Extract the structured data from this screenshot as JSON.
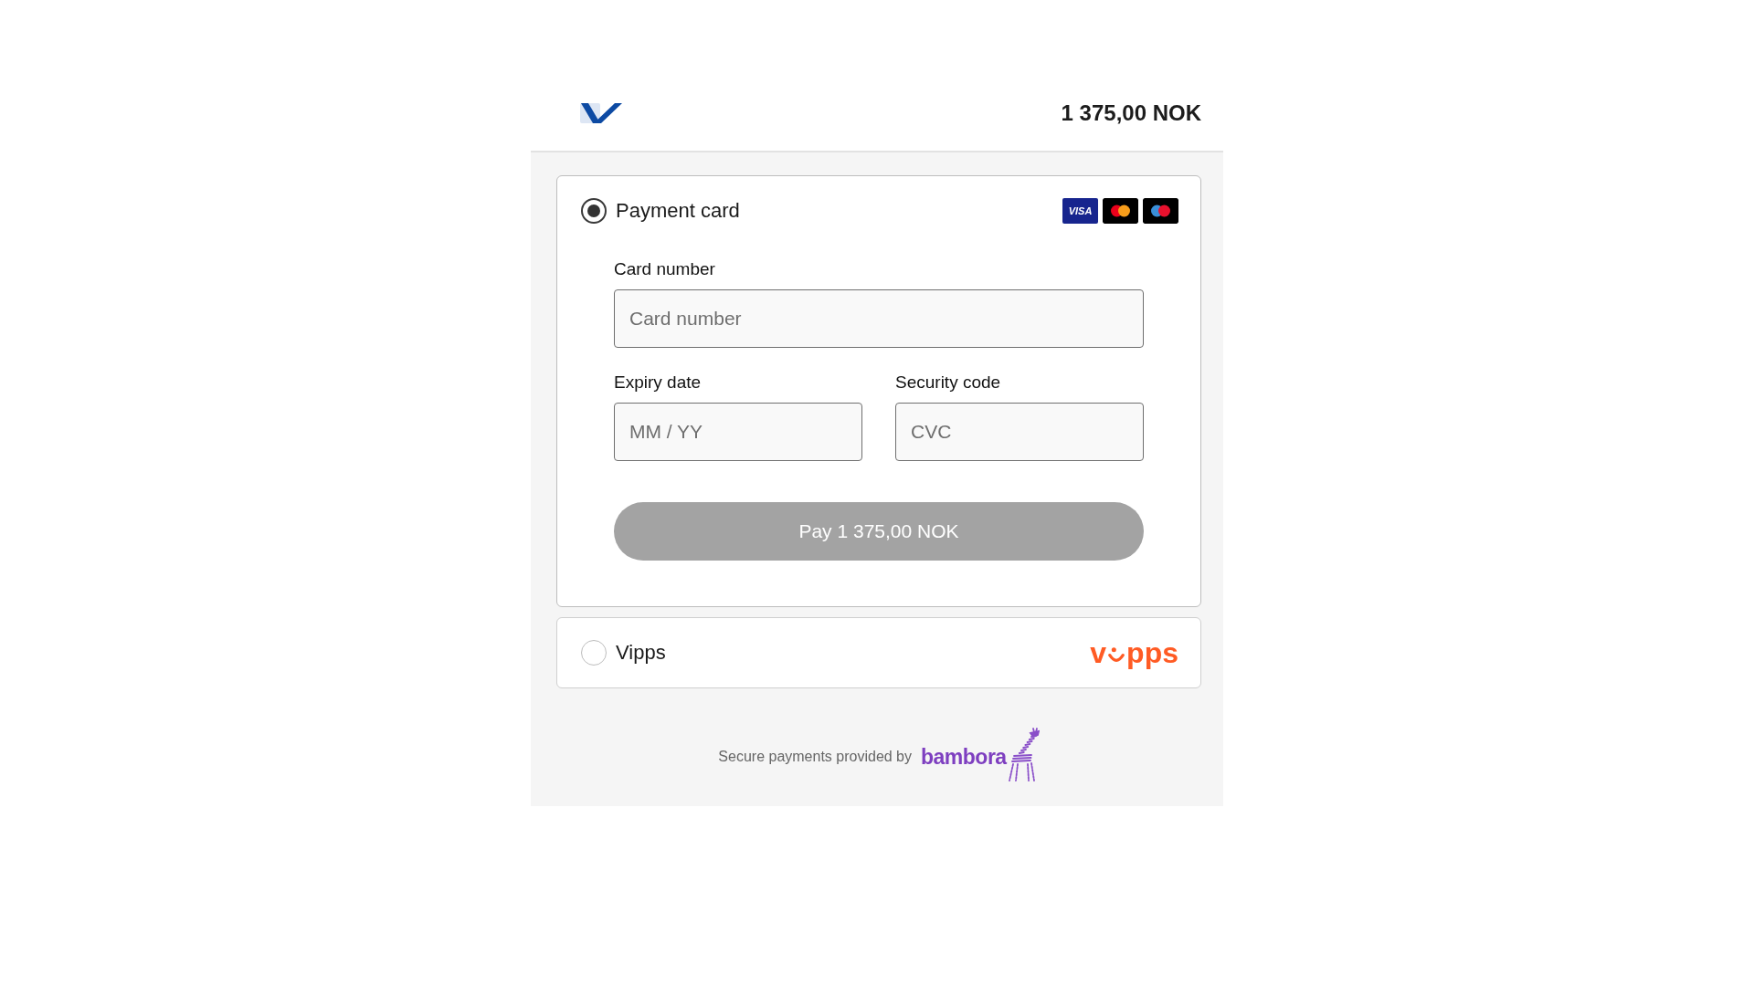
{
  "header": {
    "amount": "1 375,00 NOK"
  },
  "payment_methods": [
    {
      "kind": "card",
      "label": "Payment card",
      "selected": true,
      "card_brands": [
        {
          "kind": "visa",
          "text": "VISA"
        },
        {
          "kind": "mastercard"
        },
        {
          "kind": "maestro"
        }
      ],
      "field_rows": [
        [
          {
            "label": "Card number",
            "placeholder": "Card number"
          }
        ],
        [
          {
            "label": "Expiry date",
            "placeholder": "MM / YY"
          },
          {
            "label": "Security code",
            "placeholder": "CVC"
          }
        ]
      ],
      "pay_button": {
        "label": "Pay 1 375,00 NOK",
        "disabled": true
      }
    },
    {
      "kind": "wallet",
      "label": "Vipps",
      "selected": false,
      "wordmark": [
        "v",
        "pps"
      ]
    }
  ],
  "footer": {
    "text": "Secure payments provided by",
    "wordmark": "bambora"
  }
}
